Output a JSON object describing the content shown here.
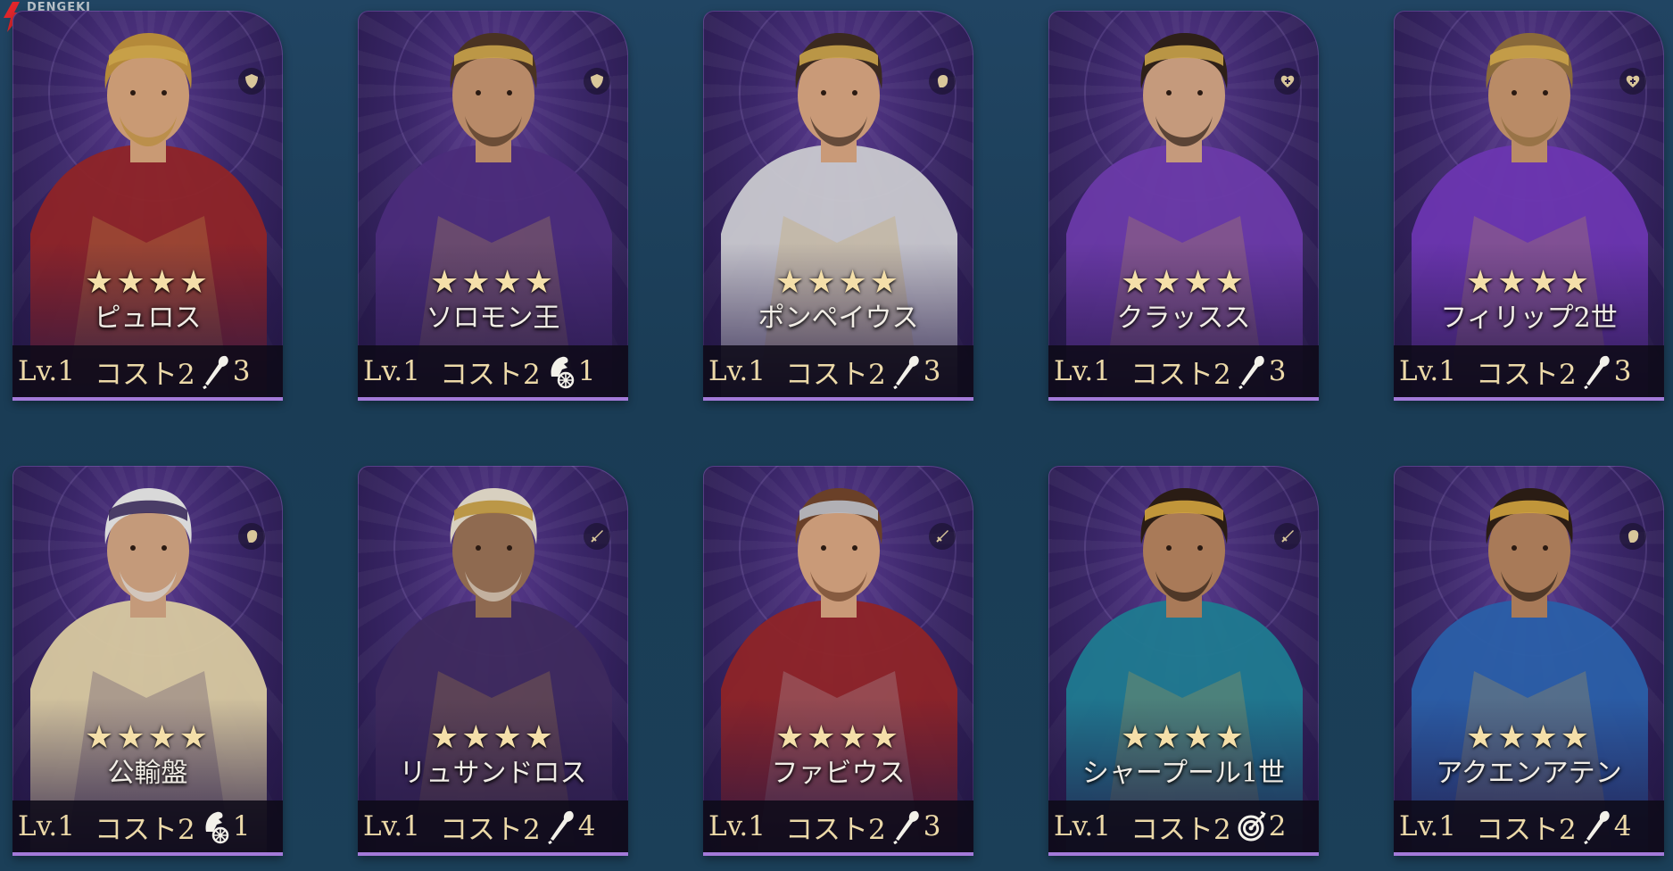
{
  "watermark": {
    "text": "DENGEKI\nONLINE"
  },
  "colors": {
    "background": "#1c3e57",
    "card_purple": "#3a2668",
    "bar_accent": "#a37ad9",
    "gold_text": "#ecd9a8",
    "star": "#f4dfa9"
  },
  "cards": [
    {
      "name": "ピュロス",
      "stars": "★★★★",
      "star_count": 4,
      "level": "Lv.1",
      "cost": "コスト2",
      "unit_icon": "spear-icon",
      "unit_count": "3",
      "role_icon": "shield-icon",
      "portrait": "blond-warrior-red-cape"
    },
    {
      "name": "ソロモン王",
      "stars": "★★★★",
      "star_count": 4,
      "level": "Lv.1",
      "cost": "コスト2",
      "unit_icon": "chariot-icon",
      "unit_count": "1",
      "role_icon": "shield-icon",
      "portrait": "bearded-king-gold-crown"
    },
    {
      "name": "ポンペイウス",
      "stars": "★★★★",
      "star_count": 4,
      "level": "Lv.1",
      "cost": "コスト2",
      "unit_icon": "spear-icon",
      "unit_count": "3",
      "role_icon": "fist-icon",
      "portrait": "laurel-roman-general"
    },
    {
      "name": "クラッスス",
      "stars": "★★★★",
      "star_count": 4,
      "level": "Lv.1",
      "cost": "コスト2",
      "unit_icon": "spear-icon",
      "unit_count": "3",
      "role_icon": "heal-icon",
      "portrait": "roman-noble-purple-robe"
    },
    {
      "name": "フィリップ2世",
      "stars": "★★★★",
      "star_count": 4,
      "level": "Lv.1",
      "cost": "コスト2",
      "unit_icon": "spear-icon",
      "unit_count": "3",
      "role_icon": "heal-icon",
      "portrait": "bearded-king-purple-cloak"
    },
    {
      "name": "公輸盤",
      "stars": "★★★★",
      "star_count": 4,
      "level": "Lv.1",
      "cost": "コスト2",
      "unit_icon": "chariot-icon",
      "unit_count": "1",
      "role_icon": "fist-icon",
      "portrait": "white-haired-sage"
    },
    {
      "name": "リュサンドロス",
      "stars": "★★★★",
      "star_count": 4,
      "level": "Lv.1",
      "cost": "コスト2",
      "unit_icon": "spear-icon",
      "unit_count": "4",
      "role_icon": "sword-icon",
      "portrait": "spartan-helmet-warrior"
    },
    {
      "name": "ファビウス",
      "stars": "★★★★",
      "star_count": 4,
      "level": "Lv.1",
      "cost": "コスト2",
      "unit_icon": "spear-icon",
      "unit_count": "3",
      "role_icon": "sword-icon",
      "portrait": "young-roman-armor"
    },
    {
      "name": "シャープール1世",
      "stars": "★★★★",
      "star_count": 4,
      "level": "Lv.1",
      "cost": "コスト2",
      "unit_icon": "target-icon",
      "unit_count": "2",
      "role_icon": "sword-icon",
      "portrait": "persian-king-red-crown"
    },
    {
      "name": "アクエンアテン",
      "stars": "★★★★",
      "star_count": 4,
      "level": "Lv.1",
      "cost": "コスト2",
      "unit_icon": "spear-icon",
      "unit_count": "4",
      "role_icon": "fist-icon",
      "portrait": "egyptian-pharaoh-blue-crown"
    }
  ]
}
